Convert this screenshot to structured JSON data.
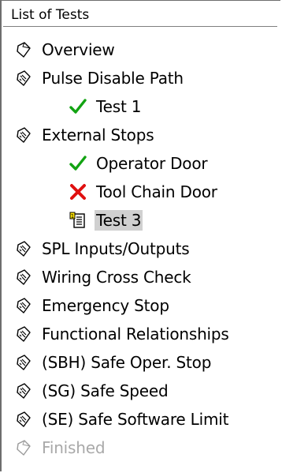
{
  "panel": {
    "title": "List of Tests"
  },
  "tree": [
    {
      "label": "Overview",
      "level": 0,
      "icon": "document-outline-icon",
      "state": "normal"
    },
    {
      "label": "Pulse Disable Path",
      "level": 0,
      "icon": "checklist-icon",
      "state": "normal"
    },
    {
      "label": "Test 1",
      "level": 1,
      "icon": "checkmark-icon",
      "state": "normal"
    },
    {
      "label": "External Stops",
      "level": 0,
      "icon": "checklist-icon",
      "state": "normal"
    },
    {
      "label": "Operator Door",
      "level": 1,
      "icon": "checkmark-icon",
      "state": "normal"
    },
    {
      "label": "Tool Chain Door",
      "level": 1,
      "icon": "cross-icon",
      "state": "normal"
    },
    {
      "label": "Test 3",
      "level": 1,
      "icon": "test-sheet-icon",
      "state": "selected"
    },
    {
      "label": "SPL Inputs/Outputs",
      "level": 0,
      "icon": "checklist-icon",
      "state": "normal"
    },
    {
      "label": "Wiring Cross Check",
      "level": 0,
      "icon": "checklist-icon",
      "state": "normal"
    },
    {
      "label": "Emergency Stop",
      "level": 0,
      "icon": "checklist-icon",
      "state": "normal"
    },
    {
      "label": "Functional Relationships",
      "level": 0,
      "icon": "checklist-icon",
      "state": "normal"
    },
    {
      "label": "(SBH) Safe Oper. Stop",
      "level": 0,
      "icon": "checklist-icon",
      "state": "normal"
    },
    {
      "label": "(SG) Safe Speed",
      "level": 0,
      "icon": "checklist-icon",
      "state": "normal"
    },
    {
      "label": "(SE) Safe Software Limit",
      "level": 0,
      "icon": "checklist-icon",
      "state": "normal"
    },
    {
      "label": "Finished",
      "level": 0,
      "icon": "flag-outline-icon",
      "state": "disabled"
    }
  ],
  "colors": {
    "check_green": "#12a312",
    "cross_red": "#e01010",
    "selected_bg": "#d0d0d0",
    "disabled_text": "#a9a9a9"
  }
}
